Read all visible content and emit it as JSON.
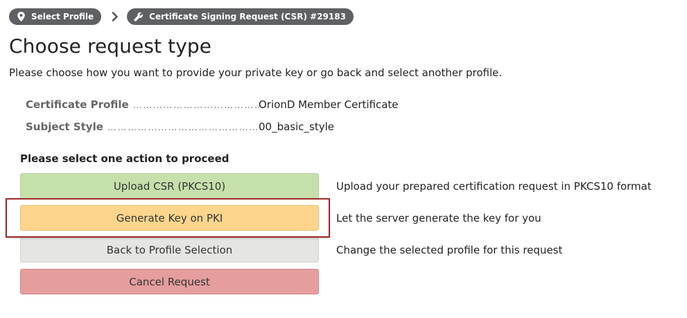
{
  "breadcrumbs": [
    {
      "label": "Select Profile",
      "icon": "map-marker-icon"
    },
    {
      "label": "Certificate Signing Request (CSR) #29183",
      "icon": "wrench-icon"
    }
  ],
  "page": {
    "title": "Choose request type",
    "description": "Please choose how you want to provide your private key or go back and select another profile."
  },
  "info": {
    "profile_label": "Certificate Profile",
    "profile_value": "OrionD Member Certificate",
    "style_label": "Subject Style",
    "style_value": "00_basic_style"
  },
  "actions": {
    "heading": "Please select one action to proceed",
    "upload": {
      "label": "Upload CSR (PKCS10)",
      "description": "Upload your prepared certification request in PKCS10 format"
    },
    "generate": {
      "label": "Generate Key on PKI",
      "description": "Let the server generate the key for you"
    },
    "back": {
      "label": "Back to Profile Selection",
      "description": "Change the selected profile for this request"
    },
    "cancel": {
      "label": "Cancel Request"
    }
  },
  "colors": {
    "breadcrumb_bg": "#5f6064",
    "upload_bg": "#c6e0ab",
    "generate_bg": "#fdd58c",
    "back_bg": "#e5e5e1",
    "cancel_bg": "#e59d9d",
    "highlight_border": "#9b2b2b"
  }
}
